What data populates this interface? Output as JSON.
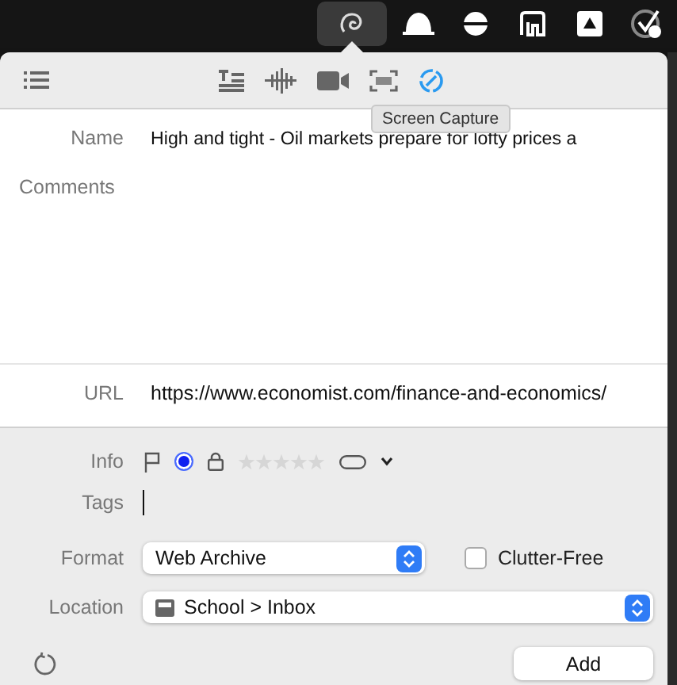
{
  "menu_bar": {
    "icons": [
      {
        "kind": "swirl",
        "selected": true
      },
      {
        "kind": "dome",
        "selected": false
      },
      {
        "kind": "disc",
        "selected": false
      },
      {
        "kind": "app",
        "selected": false
      },
      {
        "kind": "triangle",
        "selected": false
      },
      {
        "kind": "check",
        "selected": false
      }
    ]
  },
  "toolbar": {
    "modes": [
      {
        "kind": "text",
        "selected": false
      },
      {
        "kind": "audio",
        "selected": false
      },
      {
        "kind": "video",
        "selected": false
      },
      {
        "kind": "frame",
        "selected": false
      },
      {
        "kind": "compass",
        "selected": true
      }
    ],
    "tooltip": "Screen Capture"
  },
  "form": {
    "name_label": "Name",
    "name": "High and tight - Oil markets prepare for lofty prices a",
    "comments_label": "Comments",
    "url_label": "URL",
    "url": "https://www.economist.com/finance-and-economics/"
  },
  "info": {
    "label": "Info",
    "flagged": false,
    "marked": true,
    "locked": false,
    "stars": 0
  },
  "tags": {
    "label": "Tags"
  },
  "format": {
    "label": "Format",
    "value": "Web Archive",
    "clutter_free": {
      "label": "Clutter-Free",
      "checked": false
    }
  },
  "location": {
    "label": "Location",
    "value": "School > Inbox"
  },
  "add_button": "Add"
}
